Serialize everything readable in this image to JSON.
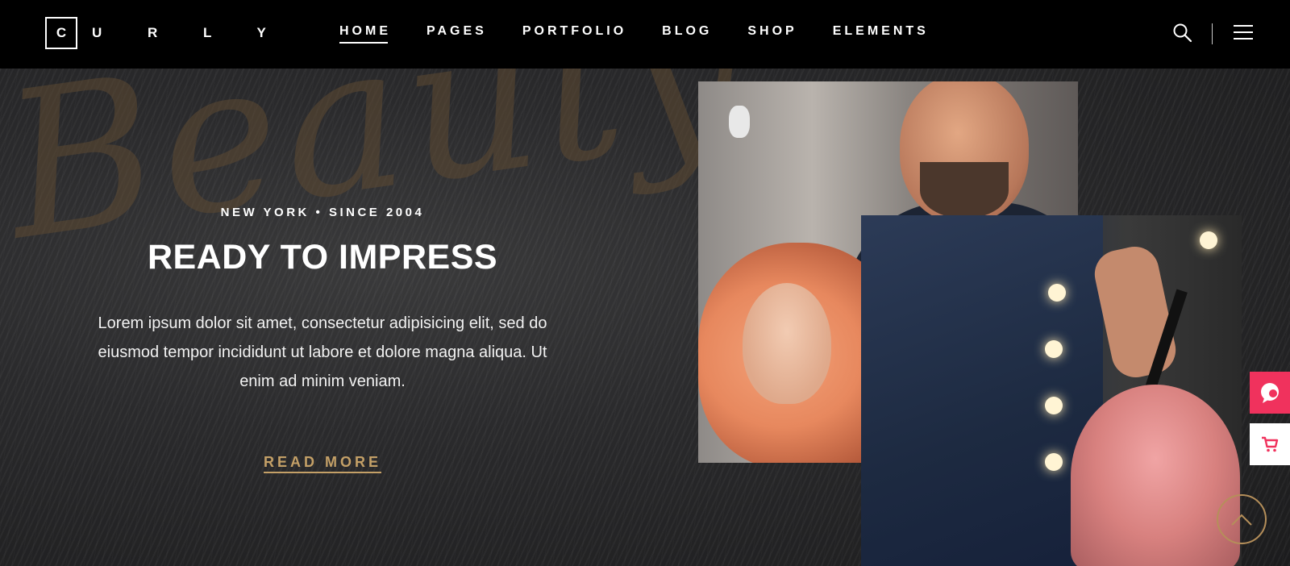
{
  "header": {
    "logo_letter": "C",
    "logo_rest": "U R L Y",
    "nav": [
      {
        "label": "HOME",
        "active": true
      },
      {
        "label": "PAGES",
        "active": false
      },
      {
        "label": "PORTFOLIO",
        "active": false
      },
      {
        "label": "BLOG",
        "active": false
      },
      {
        "label": "SHOP",
        "active": false
      },
      {
        "label": "ELEMENTS",
        "active": false
      }
    ],
    "icons": {
      "search": "search-icon",
      "menu": "hamburger-menu-icon"
    }
  },
  "hero": {
    "script_word": "Beauty",
    "eyebrow": "NEW YORK • SINCE 2004",
    "title": "READY TO IMPRESS",
    "text": "Lorem ipsum dolor sit amet, consectetur adipisicing elit, sed do eiusmod tempor incididunt ut labore et dolore magna aliqua. Ut enim ad minim veniam.",
    "cta": "READ MORE"
  },
  "side_widgets": {
    "chat_icon": "chat-bubble-icon",
    "cart_icon": "cart-icon",
    "scroll_icon": "chevron-up-icon"
  },
  "colors": {
    "accent_gold": "#c4a067",
    "accent_pink": "#f0325d",
    "header_bg": "#000000"
  }
}
